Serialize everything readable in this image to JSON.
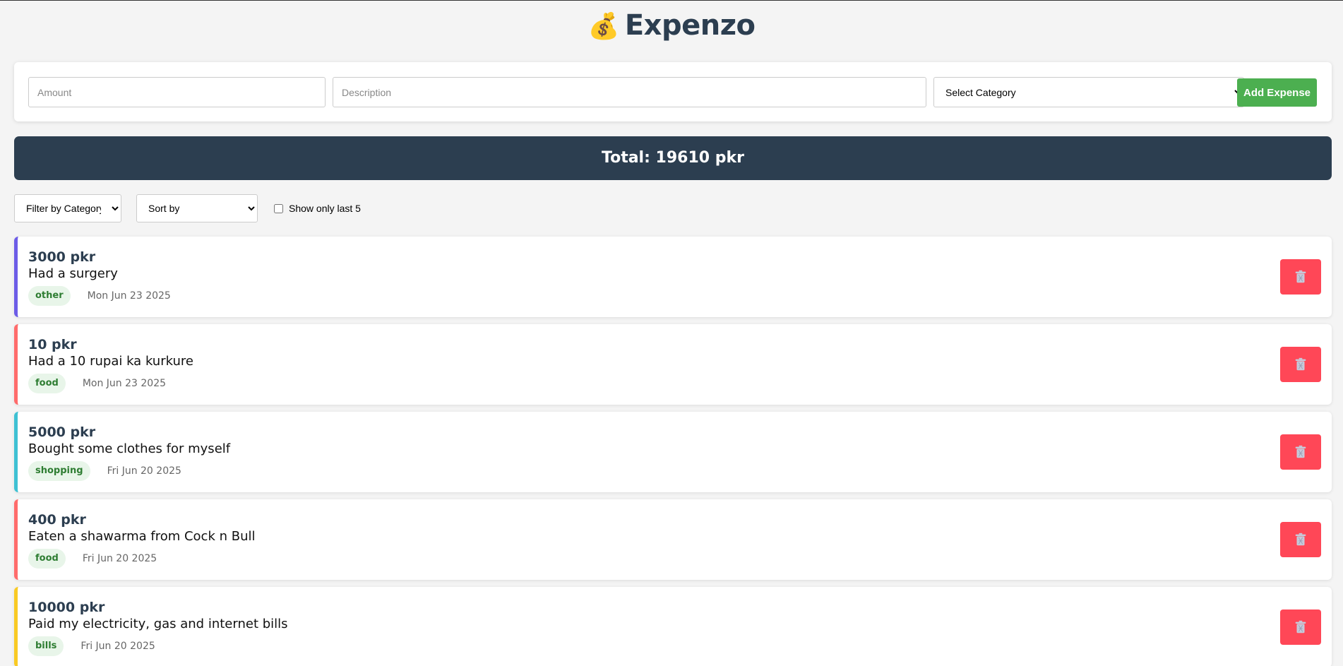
{
  "app": {
    "title": "Expenzo",
    "logo_icon": "money-bag-icon",
    "logo_glyph": "💰"
  },
  "form": {
    "amount_placeholder": "Amount",
    "description_placeholder": "Description",
    "category_selected": "Select Category",
    "add_label": "Add Expense"
  },
  "summary": {
    "total_text": "Total: 19610 pkr"
  },
  "filters": {
    "filter_selected": "Filter by Category",
    "sort_selected": "Sort by",
    "last5_label": "Show only last 5",
    "last5_checked": false
  },
  "expenses": [
    {
      "amount": "3000 pkr",
      "description": "Had a surgery",
      "category": "other",
      "date": "Mon Jun 23 2025",
      "color": "#6c5ce7"
    },
    {
      "amount": "10 pkr",
      "description": "Had a 10 rupai ka kurkure",
      "category": "food",
      "date": "Mon Jun 23 2025",
      "color": "#ff6b6b"
    },
    {
      "amount": "5000 pkr",
      "description": "Bought some clothes for myself",
      "category": "shopping",
      "date": "Fri Jun 20 2025",
      "color": "#3ec1d3"
    },
    {
      "amount": "400 pkr",
      "description": "Eaten a shawarma from Cock n Bull",
      "category": "food",
      "date": "Fri Jun 20 2025",
      "color": "#ff6b6b"
    },
    {
      "amount": "10000 pkr",
      "description": "Paid my electricity, gas and internet bills",
      "category": "bills",
      "date": "Fri Jun 20 2025",
      "color": "#f9ca24"
    }
  ],
  "colors": {
    "accent_green": "#4caf50",
    "header_dark": "#2c3e50",
    "delete_red": "#ff4757"
  }
}
